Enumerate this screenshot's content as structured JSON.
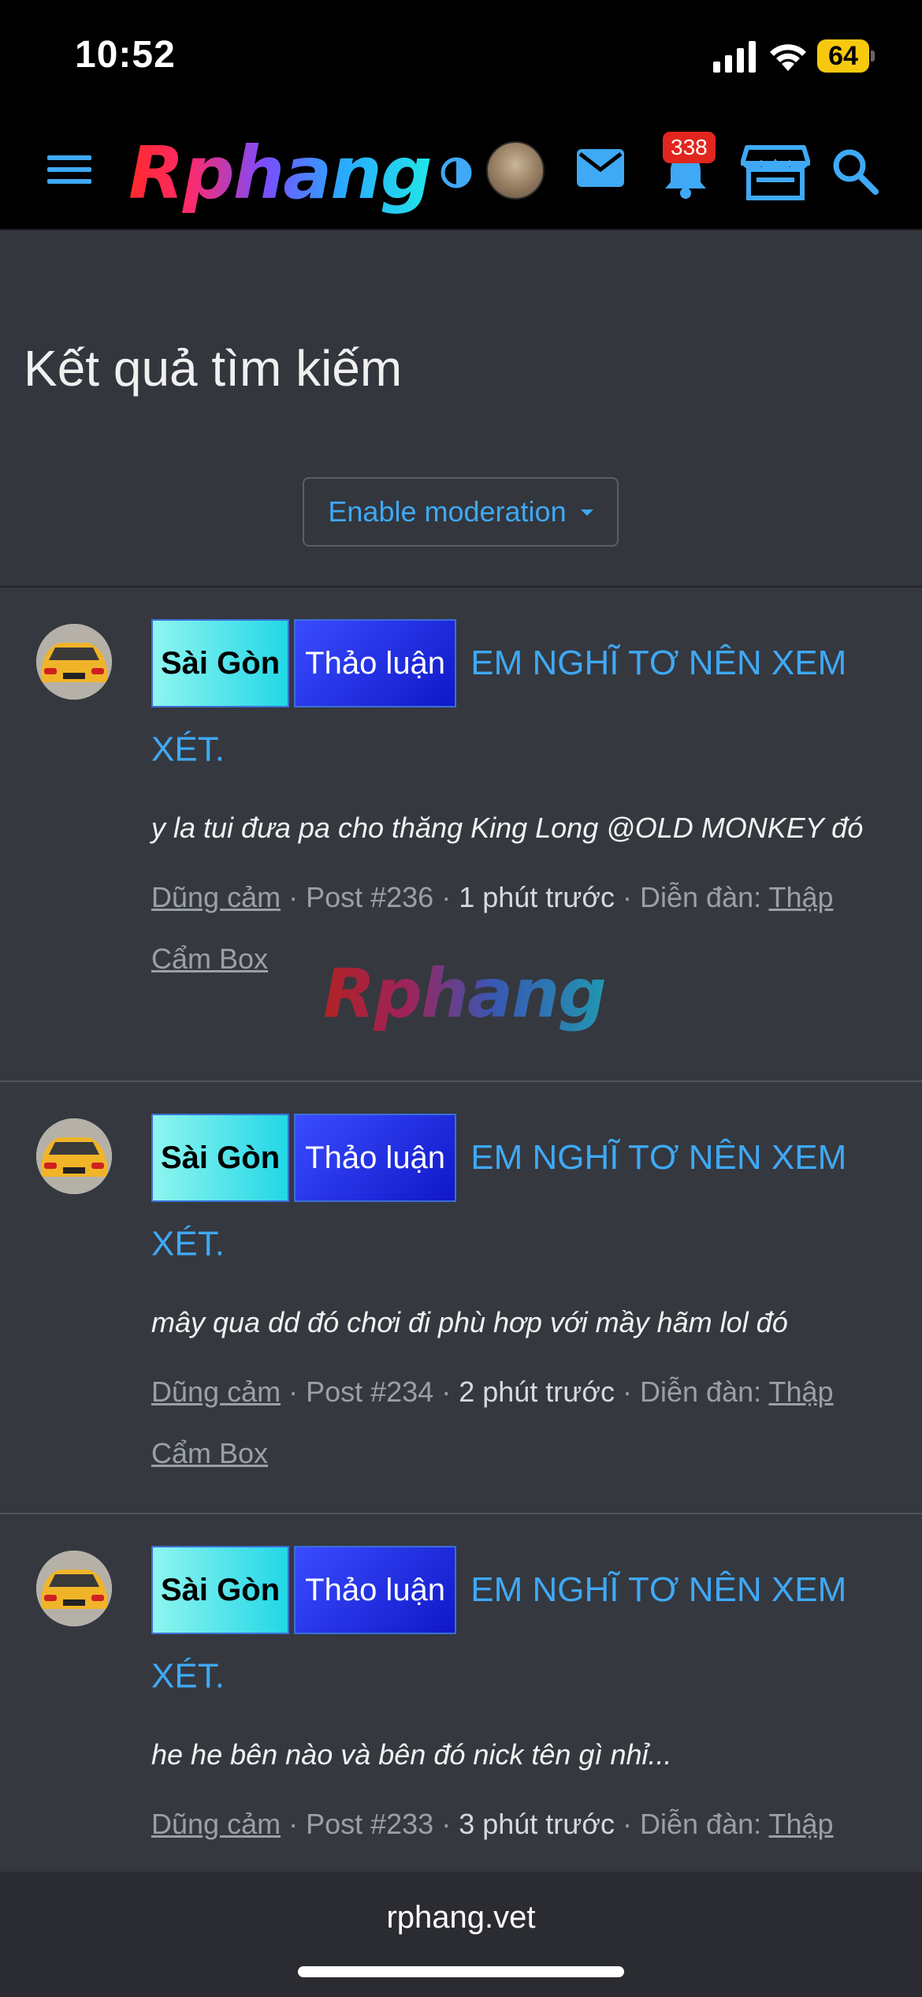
{
  "status_bar": {
    "time": "10:52",
    "battery": "64"
  },
  "header": {
    "logo": "Rphang",
    "notification_count": "338",
    "icons": [
      "menu-icon",
      "theme-toggle-icon",
      "avatar",
      "mail-icon",
      "bell-icon",
      "store-icon",
      "search-icon"
    ]
  },
  "page": {
    "title": "Kết quả tìm kiếm",
    "moderation_label": "Enable moderation"
  },
  "results": [
    {
      "prefix_city": "Sài Gòn",
      "prefix_type": "Thảo luận",
      "title": "EM NGHĨ TƠ NÊN XEM XÉT.",
      "snippet": "y la tui đưa pa cho thăng King Long @OLD MONKEY đó",
      "author": "Dũng cảm",
      "post": "Post #236",
      "time": "1 phút trước",
      "forum_label": "Diễn đàn:",
      "forum": "Thập Cẩm Box"
    },
    {
      "prefix_city": "Sài Gòn",
      "prefix_type": "Thảo luận",
      "title": "EM NGHĨ TƠ NÊN XEM XÉT.",
      "snippet": "mây qua dd đó chơi đi phù hơp với mầy hãm lol đó",
      "author": "Dũng cảm",
      "post": "Post #234",
      "time": "2 phút trước",
      "forum_label": "Diễn đàn:",
      "forum": "Thập Cẩm Box"
    },
    {
      "prefix_city": "Sài Gòn",
      "prefix_type": "Thảo luận",
      "title": "EM NGHĨ TƠ NÊN XEM XÉT.",
      "snippet": "he he bên nào và bên đó nick tên gì nhỉ...",
      "author": "Dũng cảm",
      "post": "Post #233",
      "time": "3 phút trước",
      "forum_label": "Diễn đàn:",
      "forum": "Thập Cẩm Box"
    }
  ],
  "watermark": "Rphang",
  "browser": {
    "domain": "rphang.vet"
  },
  "colors": {
    "accent": "#3fa9f5",
    "background": "#33363d",
    "header": "#000000",
    "badge": "#e0261f"
  }
}
